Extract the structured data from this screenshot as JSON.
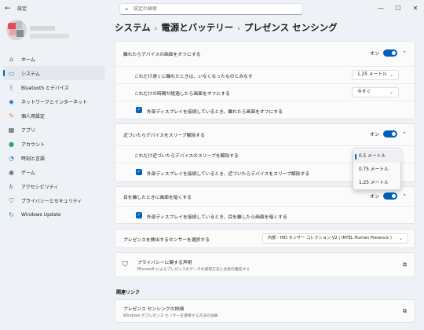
{
  "window": {
    "title": "設定",
    "back_icon": "back-arrow-icon",
    "controls": [
      "minimize-icon",
      "maximize-icon",
      "close-icon"
    ]
  },
  "search": {
    "placeholder": "設定の検索",
    "icon": "search-icon"
  },
  "breadcrumb": {
    "part1": "システム",
    "part2": "電源とバッテリー",
    "part3": "プレゼンス センシング"
  },
  "sidebar": {
    "items": [
      {
        "label": "ホーム",
        "icon": "home-icon"
      },
      {
        "label": "システム",
        "icon": "system-icon",
        "active": true
      },
      {
        "label": "Bluetooth とデバイス",
        "icon": "bluetooth-icon"
      },
      {
        "label": "ネットワークとインターネット",
        "icon": "network-icon"
      },
      {
        "label": "個人用設定",
        "icon": "brush-icon"
      },
      {
        "label": "アプリ",
        "icon": "apps-icon"
      },
      {
        "label": "アカウント",
        "icon": "account-icon"
      },
      {
        "label": "時刻と言語",
        "icon": "time-language-icon"
      },
      {
        "label": "ゲーム",
        "icon": "game-icon"
      },
      {
        "label": "アクセシビリティ",
        "icon": "accessibility-icon"
      },
      {
        "label": "プライバシーとセキュリティ",
        "icon": "shield-icon"
      },
      {
        "label": "Windows Update",
        "icon": "update-icon"
      }
    ]
  },
  "section_leave": {
    "title": "離れたらデバイスの画面をオフにする",
    "toggle_label": "オン",
    "distance_label": "これだけ遠くに離れたときは、いなくなったものとみなす",
    "distance_value": "1.25 メートル",
    "time_label": "これだけの時間が経過したら画面をオフにする",
    "time_value": "今すぐ",
    "checkbox_label": "外部ディスプレイを接続しているとき、離れたら画面をオフにする"
  },
  "section_approach": {
    "title": "近づいたらデバイスをスリープ解除する",
    "toggle_label": "オン",
    "distance_label": "これだけ近づいたらデバイスのスリープを解除する",
    "checkbox_label": "外部ディスプレイを接続しているとき、近づいたらデバイスをスリープ解除する",
    "options": [
      "0.5 メートル",
      "0.75 メートル",
      "1.25 メートル"
    ],
    "selected": "0.5 メートル"
  },
  "section_dim": {
    "title": "目を離したときに画面を暗くする",
    "toggle_label": "オン",
    "checkbox_label": "外部ディスプレイを接続しているとき、目を離したら画面を暗くする"
  },
  "sensor": {
    "label": "プレゼンスを検出するセンサーを選択する",
    "value": "内部 - HID センサー コレクション V2 ( INTEL  Human Presence )"
  },
  "privacy": {
    "title": "プライバシーに関する声明",
    "subtitle": "Microsoft によるプレゼンスのデータの使用方法と合意の確認する",
    "icon": "shield-icon"
  },
  "related": {
    "heading": "関連リンク",
    "title": "プレゼンス センシングの詳細",
    "subtitle": "Windows がプレゼンス センサーを使用する方法の詳細"
  },
  "colors": {
    "accent": "#005fb8",
    "background": "#eef1f6",
    "card": "#fbfbfc"
  }
}
